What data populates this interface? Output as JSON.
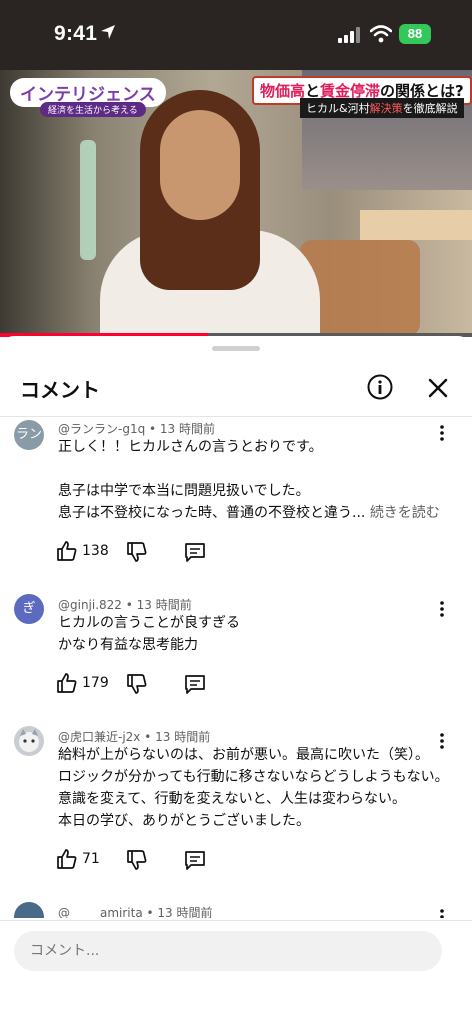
{
  "status_bar": {
    "time": "9:41",
    "battery": "88"
  },
  "video": {
    "logo_text": "インテリジェンス",
    "logo_subtitle": "経済を生活から考える",
    "headline_part1": "物価高",
    "headline_part2": "と",
    "headline_part3": "賃金停滞",
    "headline_part4": "の関係とは?",
    "subline_part1": "ヒカル&河村",
    "subline_part2": "解決策",
    "subline_part3": "を徹底解説",
    "progress": 0.44
  },
  "sheet": {
    "title": "コメント"
  },
  "comments": [
    {
      "avatar_text": "ラン",
      "avatar_color": "#8a9ba8",
      "author": "@ランラン-g1q",
      "time": "13 時間前",
      "text": "正しく！！ヒカルさんの言うとおりです。\n\n息子は中学で本当に問題児扱いでした。\n息子は不登校になった時、普通の不登校と違う...",
      "more_label": "続きを読む",
      "likes": "138"
    },
    {
      "avatar_text": "ぎ",
      "avatar_color": "#5c6bc0",
      "author": "@ginji.822",
      "time": "13 時間前",
      "text": "ヒカルの言うことが良すぎる\nかなり有益な思考能力",
      "likes": "179"
    },
    {
      "avatar_text": "",
      "avatar_color": "#c9ccd1",
      "author": "@虎口兼近-j2x",
      "time": "13 時間前",
      "text": "給料が上がらないのは、お前が悪い。最高に吹いた（笑）。\nロジックが分かっても行動に移さないならどうしようもない。\n意識を変えて、行動を変えないと、人生は変わらない。\n本日の学び、ありがとうございました。",
      "likes": "71"
    },
    {
      "avatar_text": "",
      "avatar_color": "#4a6a8a",
      "author": "@_____amirita",
      "time": "13 時間前"
    }
  ],
  "input": {
    "placeholder": "コメント..."
  },
  "colors": {
    "accent": "#ff0033",
    "battery": "#34c759"
  }
}
